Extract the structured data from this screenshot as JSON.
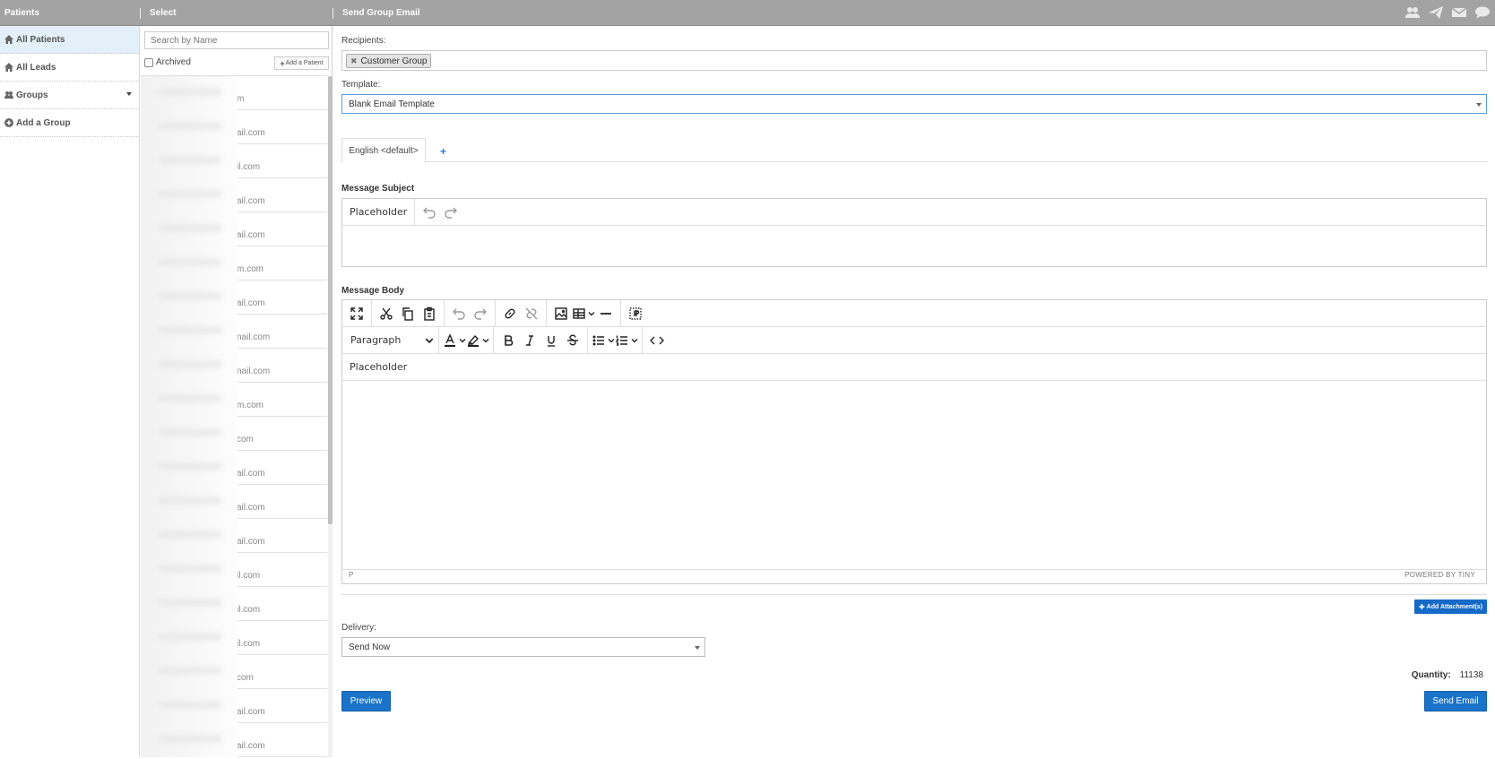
{
  "header": {
    "patients_title": "Patients",
    "select_title": "Select",
    "main_title": "Send Group Email"
  },
  "top_icons": [
    "users-icon",
    "paper-plane-icon",
    "envelope-icon",
    "chat-icon"
  ],
  "left_nav": {
    "items": [
      {
        "label": "All Patients",
        "icon": "home-icon",
        "active": true
      },
      {
        "label": "All Leads",
        "icon": "home-icon"
      },
      {
        "label": "Groups",
        "icon": "users-icon",
        "has_dropdown": true
      },
      {
        "label": "Add a Group",
        "icon": "plus-circle-icon"
      }
    ]
  },
  "select_panel": {
    "search_placeholder": "Search by Name",
    "archived_label": "Archived",
    "add_patient_label": "Add a Patient",
    "emails": [
      "m",
      "ail.com",
      "il.com",
      "ail.com",
      "ail.com",
      "m.com",
      "ail.com",
      "nail.com",
      "nail.com",
      "m.com",
      "com",
      "ail.com",
      "ail.com",
      "ail.com",
      "il.com",
      "il.com",
      "il.com",
      "com",
      "ail.com",
      "ail.com"
    ]
  },
  "form": {
    "recipients_label": "Recipients:",
    "recipient_chip": "Customer Group",
    "template_label": "Template:",
    "template_value": "Blank Email Template",
    "language_tab": "English <default>",
    "add_language": "+",
    "subject_label": "Message Subject",
    "subject_placeholder_btn": "Placeholder",
    "body_label": "Message Body",
    "block_format": "Paragraph",
    "body_placeholder_btn": "Placeholder",
    "status_path": "P",
    "powered_by": "POWERED BY TINY",
    "add_attachment": "Add Attachment(s)",
    "delivery_label": "Delivery:",
    "delivery_value": "Send Now",
    "quantity_label": "Quantity:",
    "quantity_value": "11138",
    "preview_button": "Preview",
    "send_button": "Send Email"
  },
  "colors": {
    "topbar": "#a3a3a3",
    "active_nav": "#e3f0f9",
    "primary_button": "#1a73c9",
    "template_border": "#5b9dd9"
  }
}
